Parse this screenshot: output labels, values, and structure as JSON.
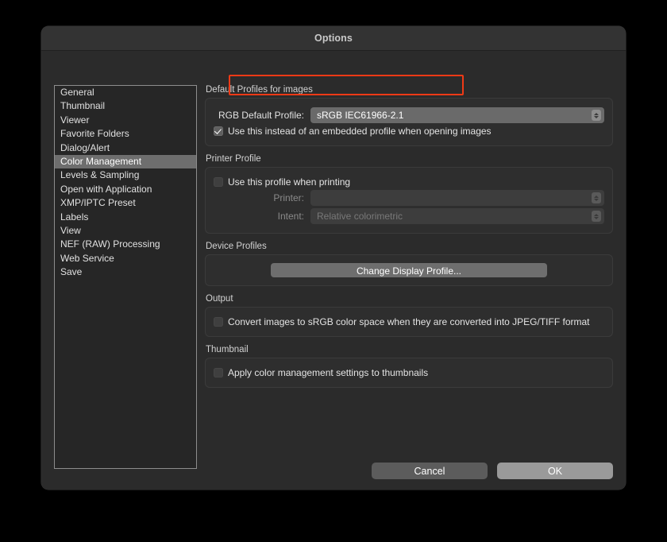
{
  "window": {
    "title": "Options"
  },
  "sidebar": {
    "items": [
      {
        "label": "General",
        "selected": false
      },
      {
        "label": "Thumbnail",
        "selected": false
      },
      {
        "label": "Viewer",
        "selected": false
      },
      {
        "label": "Favorite Folders",
        "selected": false
      },
      {
        "label": "Dialog/Alert",
        "selected": false
      },
      {
        "label": "Color Management",
        "selected": true
      },
      {
        "label": "Levels & Sampling",
        "selected": false
      },
      {
        "label": "Open with Application",
        "selected": false
      },
      {
        "label": "XMP/IPTC Preset",
        "selected": false
      },
      {
        "label": "Labels",
        "selected": false
      },
      {
        "label": "View",
        "selected": false
      },
      {
        "label": "NEF (RAW) Processing",
        "selected": false
      },
      {
        "label": "Web Service",
        "selected": false
      },
      {
        "label": "Save",
        "selected": false
      }
    ]
  },
  "sections": {
    "default_profiles": {
      "title": "Default Profiles for images",
      "rgb_label": "RGB Default Profile:",
      "rgb_value": "sRGB IEC61966-2.1",
      "use_instead_label": "Use this instead of an embedded profile when opening images",
      "use_instead_checked": true
    },
    "printer_profile": {
      "title": "Printer Profile",
      "use_when_printing_label": "Use this profile when printing",
      "use_when_printing_checked": false,
      "printer_label": "Printer:",
      "printer_value": "",
      "intent_label": "Intent:",
      "intent_value": "Relative colorimetric"
    },
    "device_profiles": {
      "title": "Device Profiles",
      "change_display_profile_label": "Change Display Profile..."
    },
    "output": {
      "title": "Output",
      "convert_label": "Convert images to sRGB color space when they are converted into JPEG/TIFF format",
      "convert_checked": false
    },
    "thumbnail": {
      "title": "Thumbnail",
      "apply_label": "Apply color management settings to thumbnails",
      "apply_checked": false
    }
  },
  "footer": {
    "cancel_label": "Cancel",
    "ok_label": "OK"
  },
  "annotation": {
    "color": "#f03a16"
  }
}
